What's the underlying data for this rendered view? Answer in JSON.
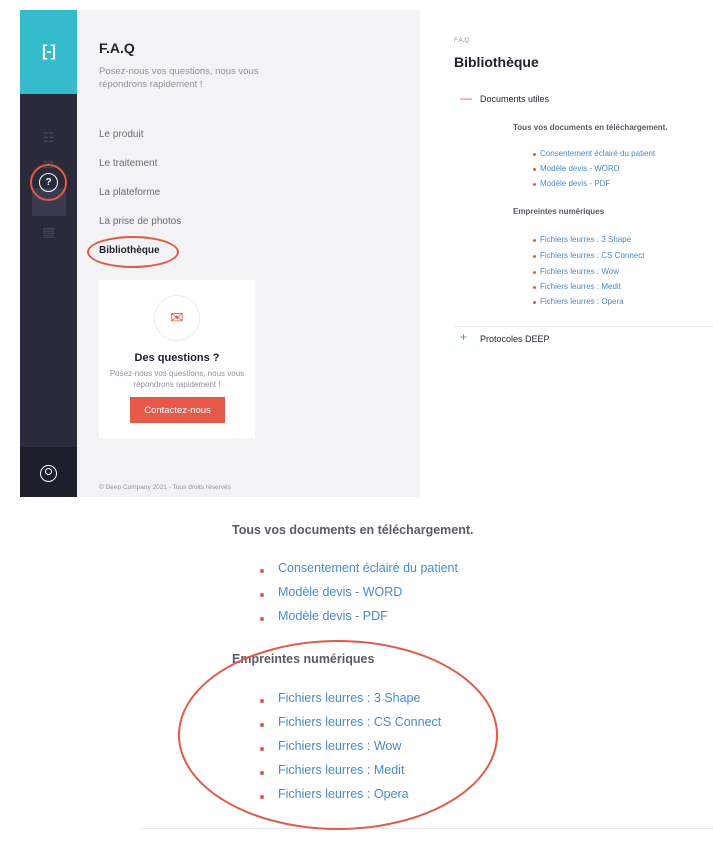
{
  "sidebar": {
    "logo": "[-]",
    "icons": [
      "list-icon",
      "mail-edit-icon",
      "help-icon",
      "notification-icon",
      "user-icon"
    ]
  },
  "faq": {
    "title": "F.A.Q",
    "subtitle": "Posez-nous vos questions, nous vous répondrons rapidement !",
    "nav": [
      "Le produit",
      "Le traitement",
      "La plateforme",
      "La prise de photos",
      "Bibliothèque"
    ],
    "active": "Bibliothèque"
  },
  "contact_card": {
    "title": "Des questions ?",
    "subtitle": "Posez-nous vos questions, nous vous répondrons rapidement !",
    "button": "Contactez-nous"
  },
  "footer": "© Deep Company 2021 - Tous droits réservés",
  "detail": {
    "breadcrumb": "F.A.Q",
    "title": "Bibliothèque",
    "accordions": [
      {
        "sign": "—",
        "label": "Documents utiles",
        "groups": [
          {
            "heading": "Tous vos documents en téléchargement.",
            "links": [
              "Consentement éclairé du patient",
              "Modèle devis - WORD",
              "Modèle devis - PDF"
            ]
          },
          {
            "heading": "Empreintes numériques",
            "links": [
              "Fichiers leurres : 3 Shape",
              "Fichiers leurres : CS Connect",
              "Fichiers leurres : Wow",
              "Fichiers leurres : Medit",
              "Fichiers leurres : Opera"
            ]
          }
        ]
      },
      {
        "sign": "+",
        "label": "Protocoles DEEP"
      }
    ]
  },
  "colors": {
    "teal": "#35bccc",
    "sidebar": "#2a2a3b",
    "accent": "#e9594a",
    "link": "#4a8ac8",
    "annotation": "#e05a47"
  }
}
